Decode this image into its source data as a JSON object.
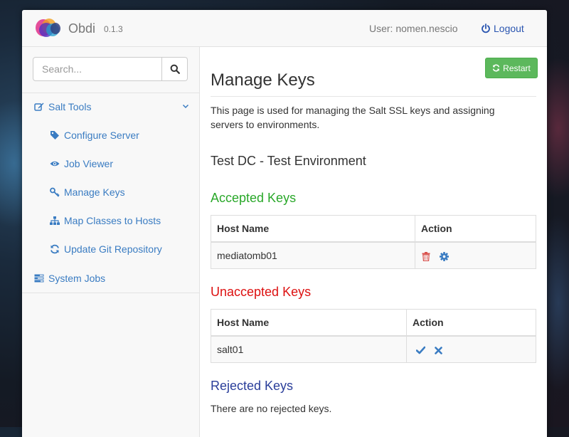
{
  "navbar": {
    "brand": "Obdi",
    "version": "0.1.3",
    "user_label": "User: nomen.nescio",
    "logout_label": "Logout"
  },
  "sidebar": {
    "search": {
      "placeholder": "Search...",
      "value": ""
    },
    "sections": [
      {
        "label": "Salt Tools",
        "icon": "edit-icon",
        "expanded": true
      },
      {
        "label": "System Jobs",
        "icon": "tasks-icon"
      }
    ],
    "items": [
      {
        "label": "Configure Server",
        "icon": "tags-icon"
      },
      {
        "label": "Job Viewer",
        "icon": "eye-icon"
      },
      {
        "label": "Manage Keys",
        "icon": "key-icon"
      },
      {
        "label": "Map Classes to Hosts",
        "icon": "sitemap-icon"
      },
      {
        "label": "Update Git Repository",
        "icon": "refresh-icon"
      }
    ]
  },
  "main": {
    "title": "Manage Keys",
    "restart_label": "Restart",
    "description": "This page is used for managing the Salt SSL keys and assigning servers to environments.",
    "environment": "Test DC - Test Environment",
    "accepted": {
      "heading": "Accepted Keys",
      "columns": [
        "Host Name",
        "Action"
      ],
      "rows": [
        {
          "host": "mediatomb01",
          "actions": [
            "trash-icon",
            "gear-icon"
          ]
        }
      ]
    },
    "unaccepted": {
      "heading": "Unaccepted Keys",
      "columns": [
        "Host Name",
        "Action"
      ],
      "rows": [
        {
          "host": "salt01",
          "actions": [
            "check-icon",
            "close-icon"
          ]
        }
      ]
    },
    "rejected": {
      "heading": "Rejected Keys",
      "empty_message": "There are no rejected keys."
    }
  },
  "colors": {
    "link": "#3a7cc2",
    "accepted": "#2aa82a",
    "unaccepted": "#dd1111",
    "rejected": "#2a3e9a",
    "restart_button": "#5cb85c",
    "delete_action": "#d9534f"
  }
}
